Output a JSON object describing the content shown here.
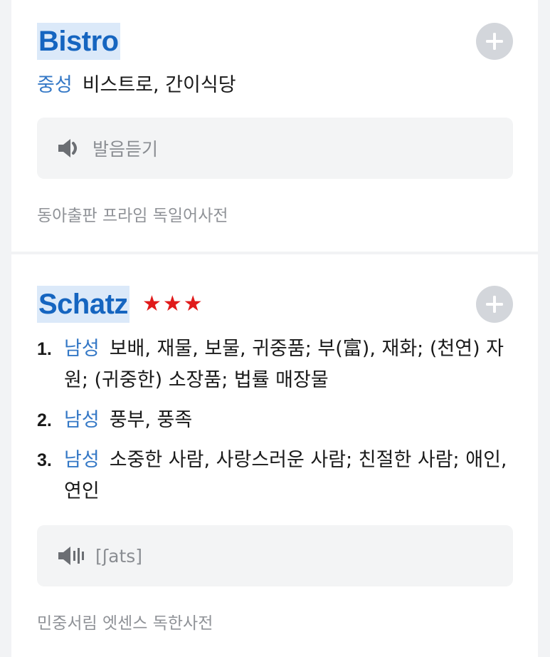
{
  "entries": [
    {
      "headword": "Bistro",
      "stars": "",
      "senses": [
        {
          "pos": "중성",
          "meaning": "비스트로, 간이식당"
        }
      ],
      "audio_label": "발음듣기",
      "audio_icon": "speaker-icon",
      "source": "동아출판 프라임 독일어사전"
    },
    {
      "headword": "Schatz",
      "stars": "★★★",
      "senses": [
        {
          "num": "1.",
          "pos": "남성",
          "meaning": "보배, 재물, 보물, 귀중품; 부(富), 재화; (천연) 자원; (귀중한) 소장품; 법률 매장물"
        },
        {
          "num": "2.",
          "pos": "남성",
          "meaning": "풍부, 풍족"
        },
        {
          "num": "3.",
          "pos": "남성",
          "meaning": "소중한 사람, 사랑스러운 사람; 친절한 사람; 애인, 연인"
        }
      ],
      "audio_label": "[ʃats]",
      "audio_icon": "speaker-wave-icon",
      "source": "민중서림 엣센스 독한사전"
    }
  ],
  "colors": {
    "headword": "#1565c0",
    "headword_highlight": "#dbe9f9",
    "pos": "#3478c6",
    "stars": "#e01a1a",
    "add_button": "#d3d6db"
  }
}
